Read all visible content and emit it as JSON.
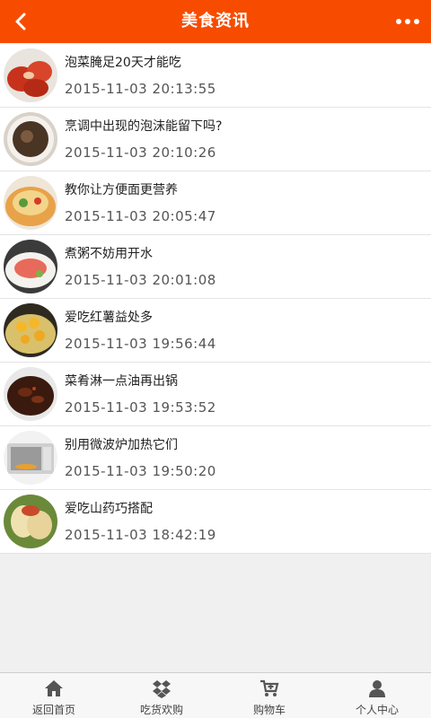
{
  "header": {
    "title": "美食资讯",
    "back_icon": "chevron-left-icon",
    "more_icon": "more-dots-icon",
    "color": "#f74c00"
  },
  "articles": [
    {
      "title": "泡菜腌足20天才能吃",
      "time": "2015-11-03 20:13:55"
    },
    {
      "title": "烹调中出现的泡沫能留下吗?",
      "time": "2015-11-03 20:10:26"
    },
    {
      "title": "教你让方便面更营养",
      "time": "2015-11-03 20:05:47"
    },
    {
      "title": "煮粥不妨用开水",
      "time": "2015-11-03 20:01:08"
    },
    {
      "title": "爱吃红薯益处多",
      "time": "2015-11-03 19:56:44"
    },
    {
      "title": "菜肴淋一点油再出锅",
      "time": "2015-11-03 19:53:52"
    },
    {
      "title": "别用微波炉加热它们",
      "time": "2015-11-03 19:50:20"
    },
    {
      "title": "爱吃山药巧搭配",
      "time": "2015-11-03 18:42:19"
    }
  ],
  "tabbar": {
    "home": {
      "label": "返回首页",
      "icon": "home-icon"
    },
    "foodie": {
      "label": "吃货欢购",
      "icon": "dropbox-icon"
    },
    "cart": {
      "label": "购物车",
      "icon": "cart-icon"
    },
    "profile": {
      "label": "个人中心",
      "icon": "user-icon"
    }
  }
}
